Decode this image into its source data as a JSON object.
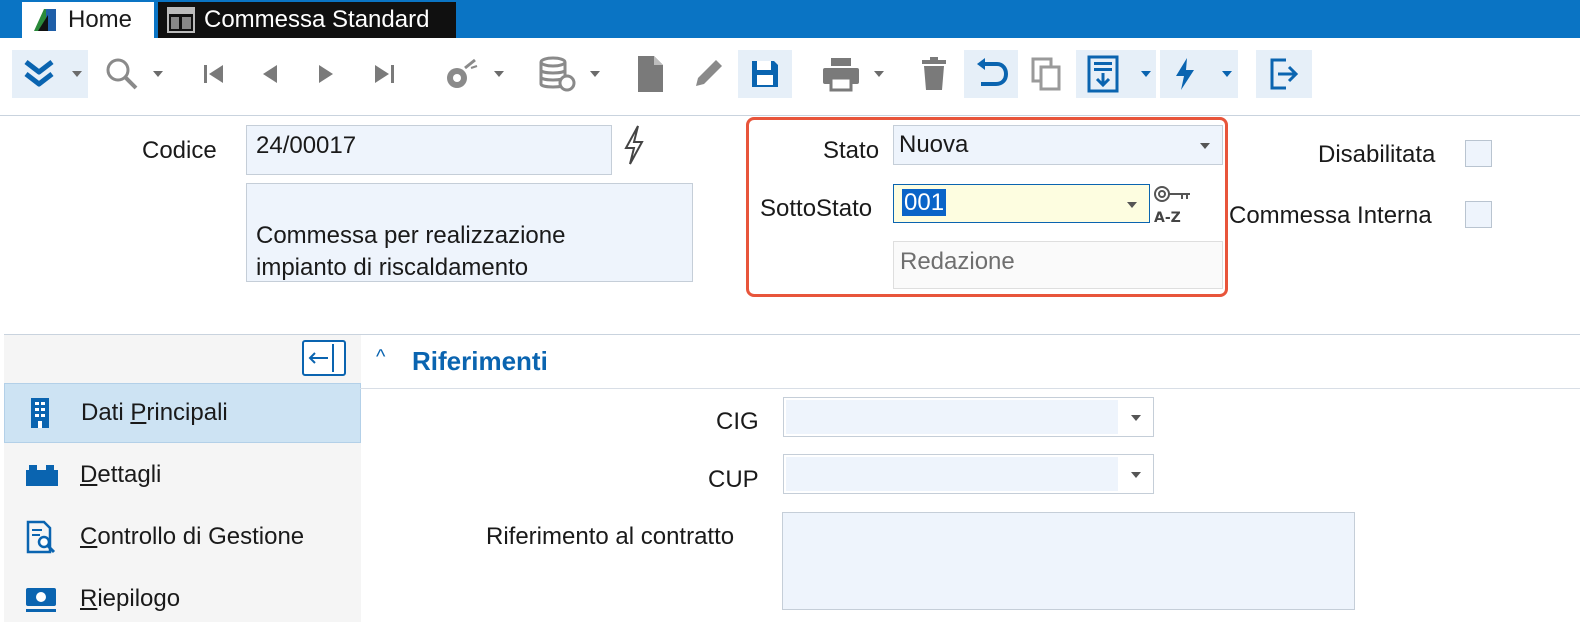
{
  "tabs": [
    {
      "label": "Home",
      "icon": "app-logo-icon"
    },
    {
      "label": "Commessa Standard",
      "icon": "window-layout-icon"
    }
  ],
  "toolbar": {
    "items": [
      "expand-menu-icon",
      "search-icon",
      "first-record-icon",
      "previous-record-icon",
      "next-record-icon",
      "last-record-icon",
      "wand-icon",
      "database-icon",
      "new-document-icon",
      "edit-icon",
      "save-icon",
      "print-icon",
      "delete-icon",
      "undo-icon",
      "copy-icon",
      "document-import-icon",
      "action-lightning-icon",
      "exit-icon"
    ]
  },
  "header": {
    "codice_label": "Codice",
    "codice_value": "24/00017",
    "descrizione_value": "Commessa per realizzazione\nimpianto di riscaldamento",
    "stato_label": "Stato",
    "stato_value": "Nuova",
    "sottostato_label": "SottoStato",
    "sottostato_value": "001",
    "sottostato_desc": "Redazione",
    "disabilitata_label": "Disabilitata",
    "disabilitata_checked": false,
    "interna_label": "Commessa Interna",
    "interna_checked": false
  },
  "sidebar": {
    "items": [
      {
        "label": "Dati Principali",
        "accel": "P",
        "active": true
      },
      {
        "label": "Dettagli",
        "accel": "D",
        "active": false
      },
      {
        "label": "Controllo di Gestione",
        "accel": "C",
        "active": false
      },
      {
        "label": "Riepilogo",
        "accel": "R",
        "active": false
      }
    ]
  },
  "section": {
    "title": "Riferimenti",
    "cig_label": "CIG",
    "cig_value": "",
    "cup_label": "CUP",
    "cup_value": "",
    "contratto_label": "Riferimento al contratto",
    "contratto_value": ""
  },
  "colors": {
    "accent": "#0a74c4",
    "highlight": "#e8553b",
    "field_bg": "#eef4fc",
    "selected_text_bg": "#0a64c8"
  }
}
